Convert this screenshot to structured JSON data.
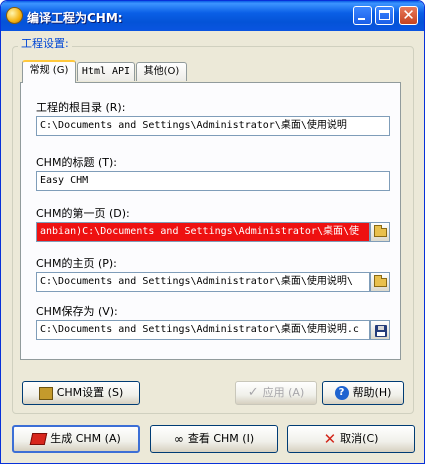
{
  "window": {
    "title": "编译工程为CHM:",
    "minimize_glyph": "",
    "maximize_glyph": "",
    "close_glyph": "✕"
  },
  "group": {
    "label": "工程设置:"
  },
  "tabs": [
    {
      "label": "常规 (G)",
      "active": true
    },
    {
      "label": "Html API",
      "active": false
    },
    {
      "label": "其他(O)",
      "active": false
    }
  ],
  "fields": {
    "root_dir": {
      "label": "工程的根目录 (R):",
      "value": "C:\\Documents and Settings\\Administrator\\桌面\\使用说明"
    },
    "chm_title": {
      "label": "CHM的标题 (T):",
      "value": "Easy CHM"
    },
    "first_page": {
      "label": "CHM的第一页 (D):",
      "value": "anbian)C:\\Documents and Settings\\Administrator\\桌面\\使"
    },
    "home_page": {
      "label": "CHM的主页 (P):",
      "value": "C:\\Documents and Settings\\Administrator\\桌面\\使用说明\\"
    },
    "save_as": {
      "label": "CHM保存为 (V):",
      "value": "C:\\Documents and Settings\\Administrator\\桌面\\使用说明.c"
    }
  },
  "buttons": {
    "chm_settings": "CHM设置 (S)",
    "apply": "应用 (A)",
    "help": "帮助(H)",
    "build": "生成 CHM (A)",
    "view": "查看 CHM (I)",
    "cancel": "取消(C)"
  },
  "icons": {
    "help_glyph": "?",
    "apply_glyph": "✓",
    "view_glyph": "∞",
    "cancel_glyph": "✕"
  },
  "colors": {
    "title_bar": "#0a5fe6",
    "selected_field": "#ee1111",
    "group_label": "#0046d5"
  }
}
